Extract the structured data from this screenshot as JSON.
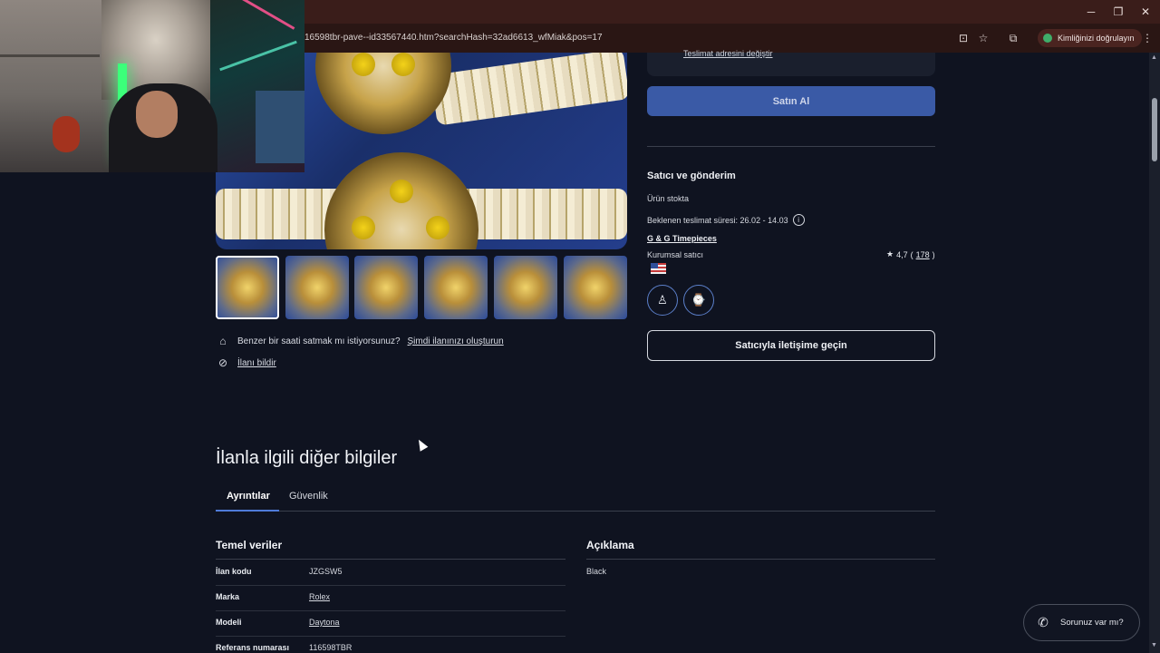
{
  "browser": {
    "url": "16598tbr-pave--id33567440.htm?searchHash=32ad6613_wfMiak&pos=17",
    "profile_label": "Kimliğinizi doğrulayın",
    "icons": [
      "install-icon",
      "star-icon",
      "extensions-icon",
      "menu-icon"
    ],
    "window_controls": {
      "minimize": "─",
      "maximize": "❐",
      "close": "✕"
    }
  },
  "listing": {
    "address_link": "Teslimat adresini değiştir",
    "buy_button": "Satın Al",
    "sell_prompt": "Benzer bir saati satmak mı istiyorsunuz?",
    "sell_link": "Şimdi ilanınızı oluşturun",
    "report_link": "İlanı bildir"
  },
  "seller": {
    "title": "Satıcı ve gönderim",
    "stock": "Ürün stokta",
    "delivery": "Beklenen teslimat süresi: 26.02 - 14.03",
    "name": "G & G Timepieces",
    "type": "Kurumsal satıcı",
    "rating": "4,7",
    "reviews": "178",
    "contact_button": "Satıcıyla iletişime geçin"
  },
  "details": {
    "title": "İlanla ilgili diğer bilgiler",
    "tabs": [
      "Ayrıntılar",
      "Güvenlik"
    ],
    "basic_title": "Temel veriler",
    "desc_title": "Açıklama",
    "desc_text": "Black",
    "rows": [
      {
        "label": "İlan kodu",
        "value": "JZGSW5"
      },
      {
        "label": "Marka",
        "value": "Rolex"
      },
      {
        "label": "Modeli",
        "value": "Daytona"
      },
      {
        "label": "Referans numarası",
        "value": "116598TBR"
      }
    ]
  },
  "help": {
    "label": "Sorunuz var mı?"
  },
  "colors": {
    "accent": "#3a5aa6",
    "background": "#0f1320",
    "tab_underline": "#4f7bd9"
  }
}
